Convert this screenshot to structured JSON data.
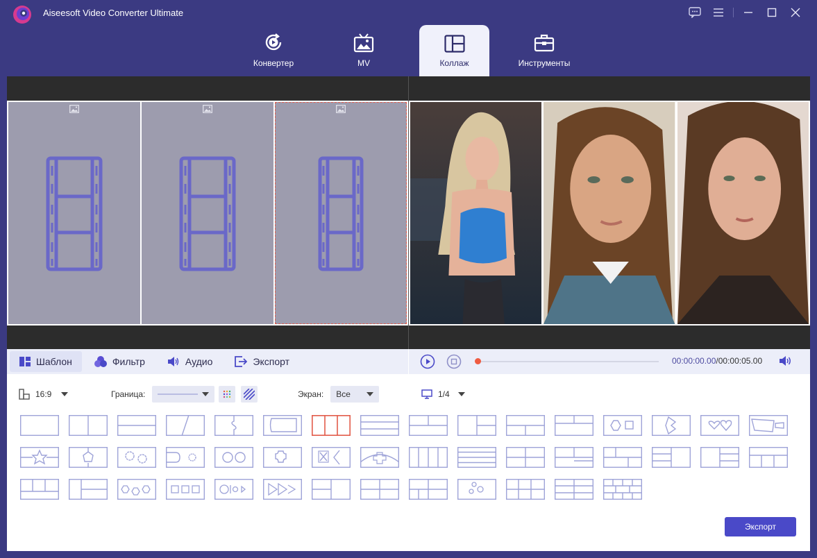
{
  "app": {
    "title": "Aiseesoft Video Converter Ultimate"
  },
  "window_controls": [
    "chat-icon",
    "menu-icon",
    "minimize-icon",
    "maximize-icon",
    "close-icon"
  ],
  "nav": {
    "tabs": [
      {
        "label": "Конвертер",
        "icon": "convert-icon"
      },
      {
        "label": "MV",
        "icon": "tv-image-icon"
      },
      {
        "label": "Коллаж",
        "icon": "collage-icon",
        "active": true
      },
      {
        "label": "Инструменты",
        "icon": "toolbox-icon"
      }
    ]
  },
  "panel_tabs": [
    {
      "label": "Шаблон",
      "icon": "template-icon",
      "active": true
    },
    {
      "label": "Фильтр",
      "icon": "filter-icon"
    },
    {
      "label": "Аудио",
      "icon": "audio-icon"
    },
    {
      "label": "Экспорт",
      "icon": "export-icon"
    }
  ],
  "player": {
    "current_time": "00:00:00.00",
    "total_time": "/00:00:05.00",
    "progress": 0
  },
  "options": {
    "aspect_ratio": "16:9",
    "border_label": "Граница:",
    "screen_label": "Экран:",
    "screen_value": "Все",
    "page": "1/4"
  },
  "export_button": "Экспорт",
  "colors": {
    "accent": "#4a49c8",
    "background": "#3b3a82",
    "selected": "#e25b4a",
    "template_stroke": "#9ea3d8"
  }
}
